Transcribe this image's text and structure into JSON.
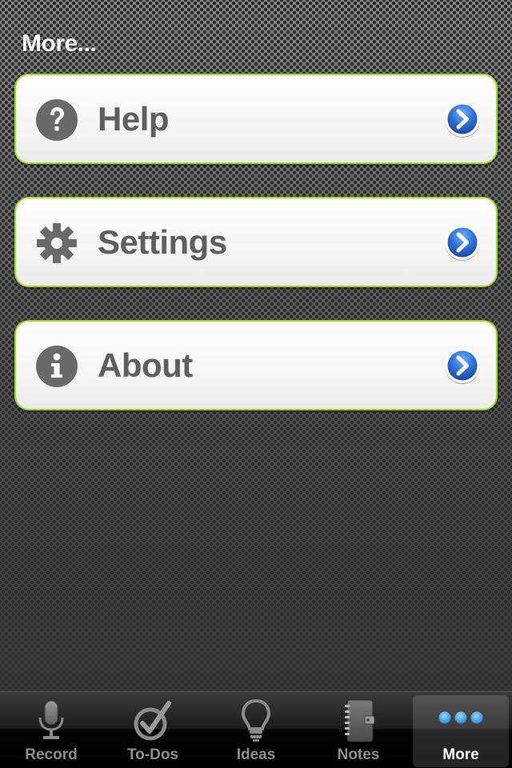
{
  "page": {
    "title": "More..."
  },
  "menu": {
    "items": [
      {
        "id": "help",
        "label": "Help",
        "icon": "help-icon"
      },
      {
        "id": "settings",
        "label": "Settings",
        "icon": "gear-icon"
      },
      {
        "id": "about",
        "label": "About",
        "icon": "info-icon"
      }
    ]
  },
  "tab_bar": {
    "tabs": [
      {
        "label": "Record",
        "icon": "microphone-icon",
        "active": false
      },
      {
        "label": "To-Dos",
        "icon": "checkmark-icon",
        "active": false
      },
      {
        "label": "Ideas",
        "icon": "lightbulb-icon",
        "active": false
      },
      {
        "label": "Notes",
        "icon": "notebook-icon",
        "active": false
      },
      {
        "label": "More",
        "icon": "more-dots-icon",
        "active": true
      }
    ]
  },
  "colors": {
    "accent_border": "#a4d61e",
    "disclosure_blue": "#2f6fd8",
    "label_gray": "#5f5f5f",
    "tab_active_dots": "#4aa8f0"
  }
}
